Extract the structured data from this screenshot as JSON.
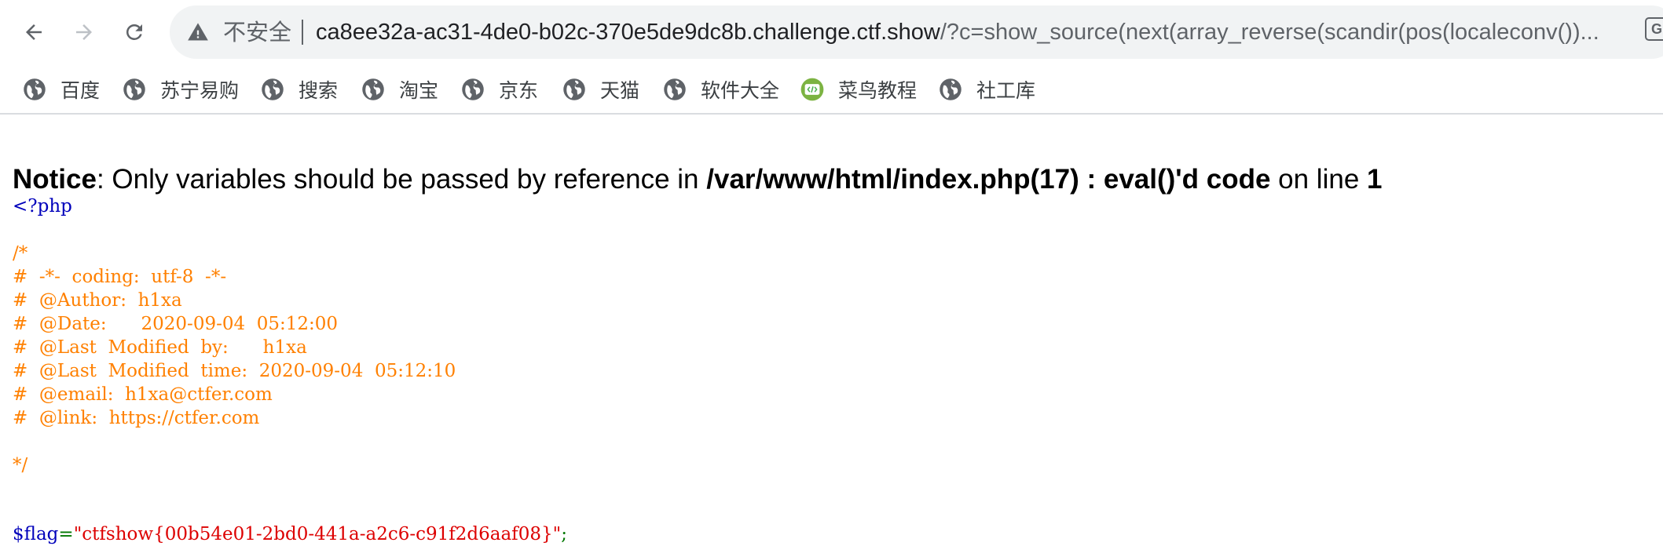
{
  "browser": {
    "security_label": "不安全",
    "url_host": "ca8ee32a-ac31-4de0-b02c-370e5de9dc8b.challenge.ctf.show",
    "url_path": "/?c=show_source(next(array_reverse(scandir(pos(localeconv())...",
    "extension_glyph": "G"
  },
  "bookmarks": [
    {
      "label": "百度",
      "icon": "globe-icon"
    },
    {
      "label": "苏宁易购",
      "icon": "globe-icon"
    },
    {
      "label": "搜索",
      "icon": "globe-icon"
    },
    {
      "label": "淘宝",
      "icon": "globe-icon"
    },
    {
      "label": "京东",
      "icon": "globe-icon"
    },
    {
      "label": "天猫",
      "icon": "globe-icon"
    },
    {
      "label": "软件大全",
      "icon": "globe-icon"
    },
    {
      "label": "菜鸟教程",
      "icon": "runoob-icon"
    },
    {
      "label": "社工库",
      "icon": "globe-icon"
    }
  ],
  "notice": {
    "label": "Notice",
    "message": ": Only variables should be passed by reference in ",
    "file": "/var/www/html/index.php(17) : eval()'d code",
    "on_line": " on line ",
    "line_no": "1"
  },
  "code": {
    "open_tag": "<?php",
    "comment_lines": [
      "/*",
      "#  -*-  coding:  utf-8  -*-",
      "#  @Author:  h1xa",
      "#  @Date:      2020-09-04  05:12:00",
      "#  @Last  Modified  by:      h1xa",
      "#  @Last  Modified  time:  2020-09-04  05:12:10",
      "#  @email:  h1xa@ctfer.com",
      "#  @link:  https://ctfer.com",
      "",
      "*/"
    ],
    "flag_var": "$flag",
    "flag_eq": "=",
    "flag_value": "\"ctfshow{00b54e01-2bd0-441a-a2c6-c91f2d6aaf08}\"",
    "flag_end": ";"
  },
  "colors": {
    "php_keyword": "#0000bb",
    "comment": "#ff8000",
    "string": "#dd0000",
    "operator": "#007700"
  }
}
